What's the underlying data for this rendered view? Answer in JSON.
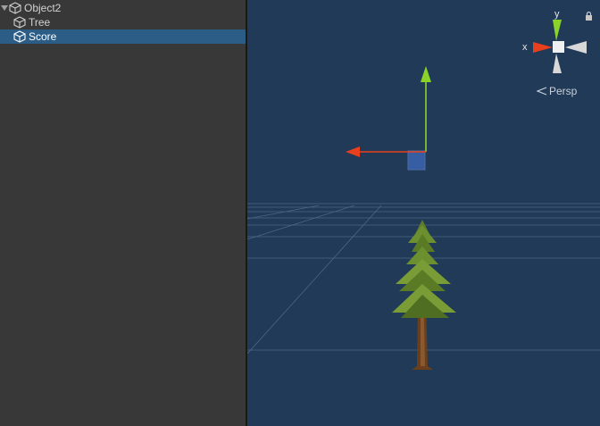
{
  "hierarchy": {
    "items": [
      {
        "label": "Object2",
        "expanded": true,
        "selected": false,
        "icon": "cube-icon"
      },
      {
        "label": "Tree",
        "selected": false,
        "icon": "cube-icon"
      },
      {
        "label": "Score",
        "selected": true,
        "icon": "cube-icon"
      }
    ]
  },
  "scene": {
    "projection_label": "Persp",
    "gizmo": {
      "y_label": "y",
      "x_label": "x"
    },
    "colors": {
      "background": "#203a57",
      "x_axis": "#e8401e",
      "y_axis": "#8ad42a",
      "z_axis": "#4a7ce0",
      "selection": "#2c5d87"
    }
  }
}
